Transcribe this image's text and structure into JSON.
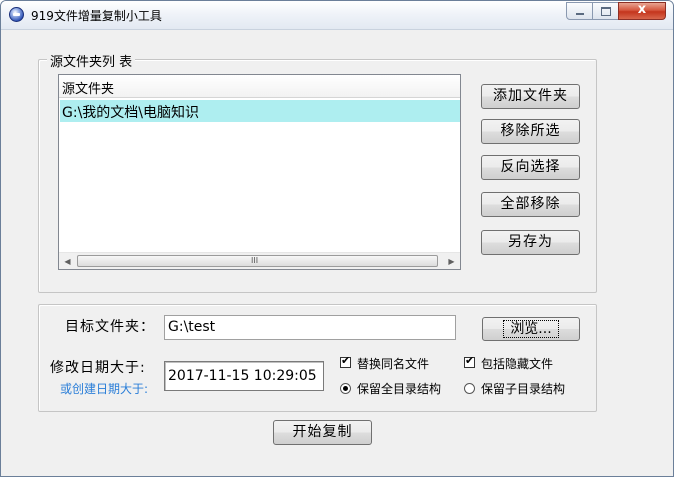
{
  "window": {
    "title": "919文件增量复制小工具",
    "close_glyph": "x"
  },
  "source_group": {
    "legend": "源文件夹列 表",
    "list": {
      "column_header": "源文件夹",
      "rows": [
        "G:\\我的文档\\电脑知识"
      ],
      "scroll_left": "◀",
      "scroll_right": "▶",
      "scroll_grip": "III"
    },
    "buttons": {
      "add": "添加文件夹",
      "remove_selected": "移除所选",
      "invert": "反向选择",
      "remove_all": "全部移除",
      "save_as": "另存为"
    }
  },
  "target_group": {
    "target_label": "目标文件夹：",
    "target_value": "G:\\test",
    "browse_label": "浏览...",
    "modified_label": "修改日期大于:",
    "created_label": "或创建日期大于:",
    "date_value": "2017-11-15 10:29:05",
    "options": {
      "replace_same_name": {
        "label": "替换同名文件",
        "checked": true
      },
      "include_hidden": {
        "label": "包括隐藏文件",
        "checked": true
      },
      "keep_full_structure": {
        "label": "保留全目录结构",
        "selected": true
      },
      "keep_sub_structure": {
        "label": "保留子目录结构",
        "selected": false
      }
    }
  },
  "start_button": "开始复制",
  "colors": {
    "selected_row": "#aeeef0",
    "accent_link": "#2a7ed8",
    "close_button": "#c4351d"
  }
}
